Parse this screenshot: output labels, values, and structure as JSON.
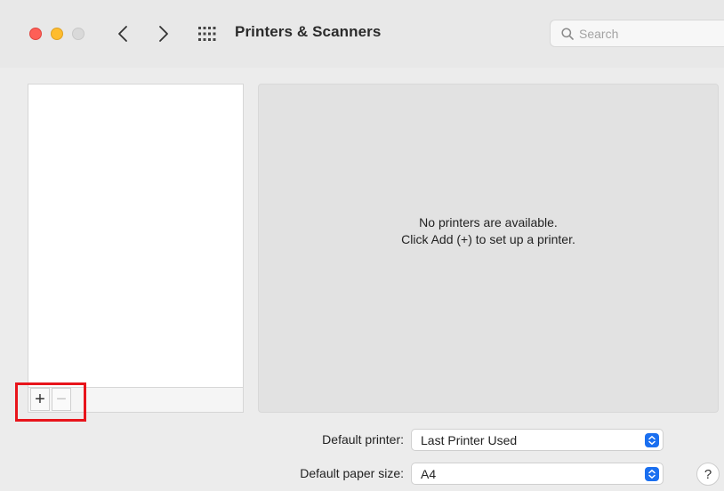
{
  "window": {
    "title": "Printers & Scanners",
    "traffic_lights": {
      "close": "#fe5f57",
      "minimize": "#febc2e",
      "zoom": "#d9d9d9"
    }
  },
  "toolbar": {
    "back_icon": "chevron-left-icon",
    "forward_icon": "chevron-right-icon",
    "grid_icon": "show-all-grid-icon",
    "search": {
      "placeholder": "Search",
      "value": "",
      "icon": "magnifier-icon"
    }
  },
  "printer_list": {
    "items": [],
    "add_label": "+",
    "remove_label": "−",
    "highlight_color": "#e8141b"
  },
  "detail": {
    "empty_line1": "No printers are available.",
    "empty_line2": "Click Add (+) to set up a printer."
  },
  "settings": {
    "default_printer": {
      "label": "Default printer:",
      "value": "Last Printer Used"
    },
    "default_paper": {
      "label": "Default paper size:",
      "value": "A4"
    },
    "accent": "#1a6ff0"
  },
  "help": {
    "label": "?"
  }
}
